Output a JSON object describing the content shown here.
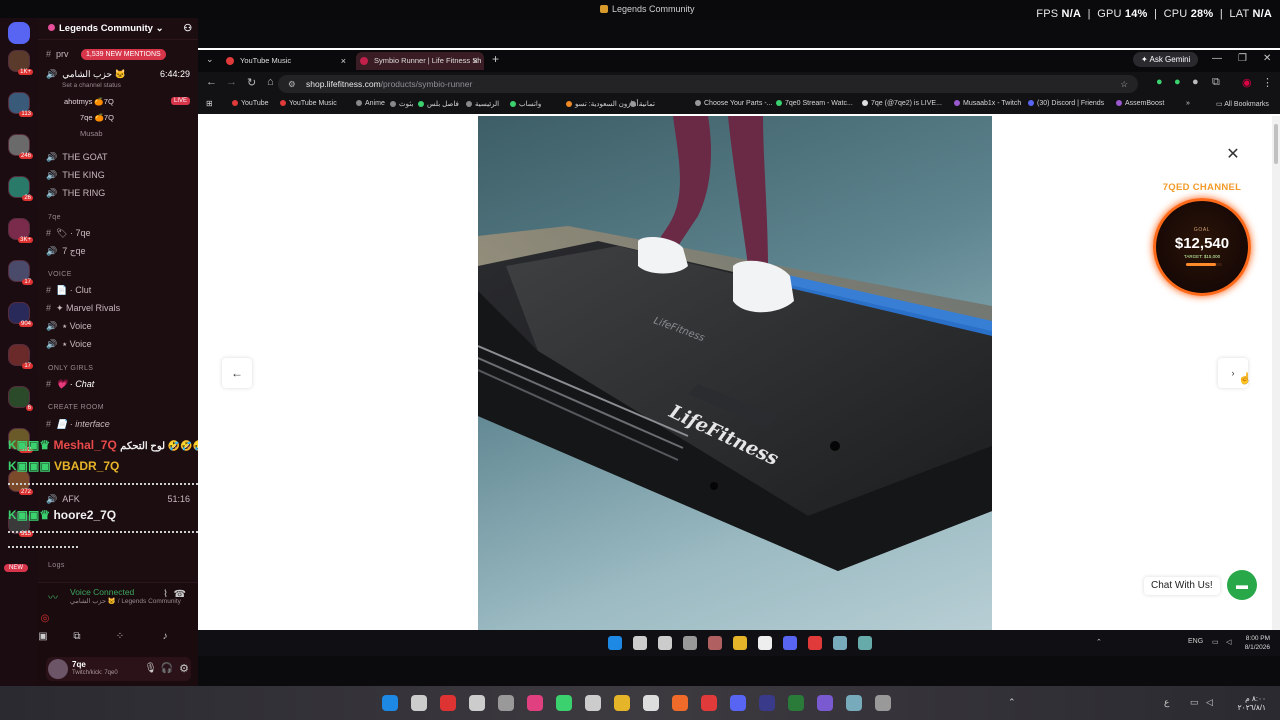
{
  "window": {
    "title": "Legends Community",
    "stats": {
      "fps_label": "FPS",
      "fps": "N/A",
      "gpu_label": "GPU",
      "gpu": "14%",
      "cpu_label": "CPU",
      "cpu": "28%",
      "lat_label": "LAT",
      "lat": "N/A"
    }
  },
  "discord": {
    "server_name": "Legends Community",
    "mentions_badge": "1,539 NEW MENTIONS",
    "rail_badges": [
      "1K+",
      "113",
      "246",
      "26",
      "3K+",
      "17",
      "904",
      "17",
      "6",
      "392",
      "272",
      "315"
    ],
    "new_badge": "NEW",
    "channels": [
      {
        "name": "prv",
        "type": "text"
      },
      {
        "name": "حزب الشامي 🐱",
        "type": "voice",
        "time": "6:44:29",
        "status": "Set a channel status"
      },
      {
        "name": "ahotmys 🍊7Q",
        "type": "user",
        "live": "LIVE"
      },
      {
        "name": "7qe 🍊7Q",
        "type": "user"
      },
      {
        "name": "Musab",
        "type": "user"
      },
      {
        "name": "THE GOAT",
        "type": "voice"
      },
      {
        "name": "THE KING",
        "type": "voice"
      },
      {
        "name": "THE RING",
        "type": "voice"
      }
    ],
    "cat_7qe": "7qe",
    "ch_7qe_a": "🏷 · 7qe",
    "ch_7qe_b": "ج 7qe",
    "cat_voice": "VOICE",
    "ch_clut": "📄 · Clut",
    "ch_marvel": "✦ Marvel Rivals",
    "ch_voice1": "⭑ Voice",
    "ch_voice2": "⭑ Voice",
    "cat_girls": "ONLY GIRLS",
    "ch_chat": "💗 · Chat",
    "cat_create": "CREATE ROOM",
    "ch_interface": "📄 · interface",
    "ch_afk": "AFK",
    "ch_afk_time": "51:16",
    "cat_logs": "Logs",
    "overlay": [
      {
        "name": "Meshal_7Q",
        "suffix": "لوح التحكم 🤣🤣🤣🤣",
        "color": "#e84a4a"
      },
      {
        "name": "VBADR_7Q",
        "suffix": "",
        "color": "#e6b429"
      },
      {
        "name": "hoore2_7Q",
        "suffix": "",
        "color": "#f0f0f0"
      }
    ],
    "voice_connected": "Voice Connected",
    "voice_channel": "حزب الشامي 🐱 / Legends Community",
    "user_name": "7qe",
    "user_status": "Twitch/kick: 7qe0"
  },
  "browser": {
    "tabs": [
      {
        "title": "YouTube Music"
      },
      {
        "title": "Symbio Runner | Life Fitness Sh"
      }
    ],
    "ask_gemini": "Ask Gemini",
    "url_host": "shop.lifefitness.com",
    "url_path": "/products/symbio-runner",
    "bookmarks": [
      "YouTube",
      "YouTube Music",
      "Anime",
      "بثوث",
      "فاصل بلس",
      "الرئيسية",
      "واتساب",
      "أمازون السعودية: تسو...",
      "تمانية",
      "Choose Your Parts -...",
      "7qe0 Stream - Watc...",
      "7qe (@7qe2) is LIVE...",
      "Musaab1x - Twitch",
      "(30) Discord | Friends",
      "AssemBoost"
    ],
    "all_bookmarks": "All Bookmarks"
  },
  "page": {
    "promo_label": "7QED CHANNEL",
    "goal_label": "GOAL",
    "goal_value": "$12,540",
    "goal_target": "TARGET: $15,000",
    "goal_progress": 0.84,
    "chat_label": "Chat With Us!",
    "brand_on_machine": "LifeFitness"
  },
  "taskbar_inner": {
    "lang": "ENG",
    "time": "8:00 PM",
    "date": "8/1/2026"
  },
  "taskbar_outer": {
    "time": "٨:٠٠ م",
    "date": "٢٠٢٦/٨/١",
    "lang": "ع"
  },
  "colors": {
    "discord_bg": "#1c0d11",
    "accent_orange": "#ff6a1a",
    "chat_green": "#29a84a",
    "mention_red": "#d6354a"
  }
}
